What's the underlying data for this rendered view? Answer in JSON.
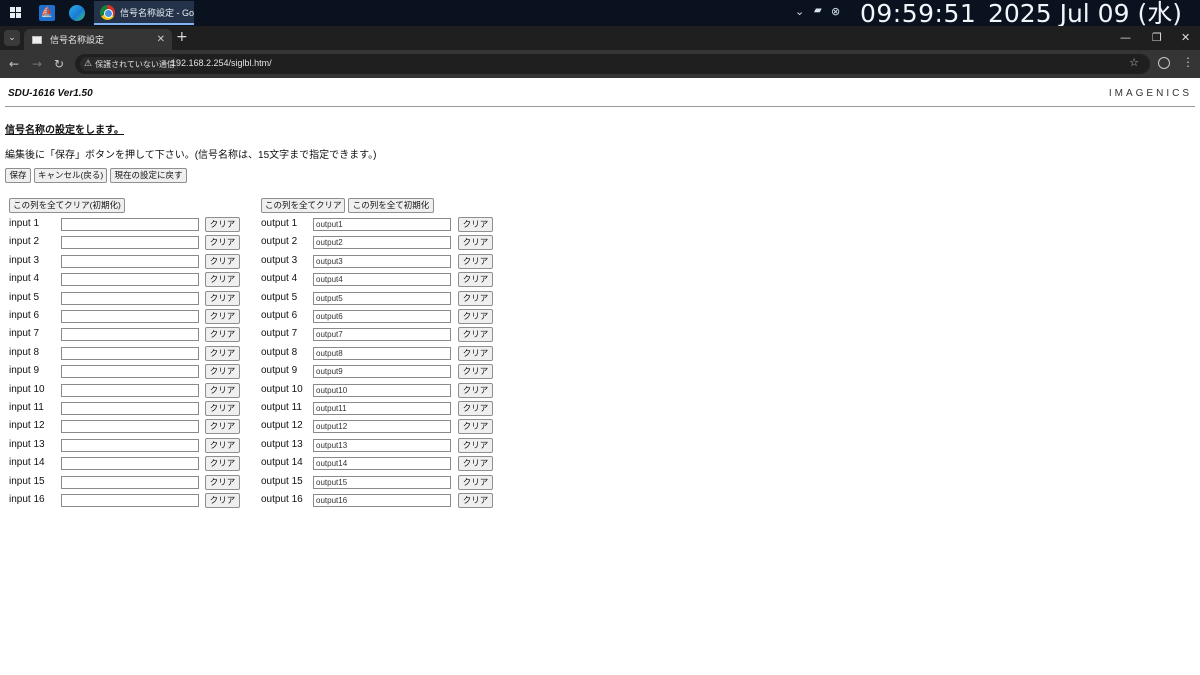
{
  "taskbar": {
    "active_window_title": "信号名称設定 - Goo...",
    "clock_time": "09:59:51",
    "clock_date": "2025   Jul 09 (水)"
  },
  "browser": {
    "tab_title": "信号名称設定",
    "security_label": "保護されていない通信",
    "url": "192.168.2.254/siglbl.htm/"
  },
  "page": {
    "product": "SDU-1616   Ver1.50",
    "brand": "IMAGENICS",
    "heading": "信号名称の設定をします。",
    "instruction": "編集後に「保存」ボタンを押して下さい。(信号名称は、15文字まで指定できます。)",
    "buttons": {
      "save": "保存",
      "cancel": "キャンセル(戻る)",
      "revert": "現在の設定に戻す"
    },
    "input_column": {
      "clear_all": "この列を全てクリア(初期化)",
      "clear_label": "クリア",
      "rows": [
        {
          "label": "input 1",
          "value": ""
        },
        {
          "label": "input 2",
          "value": ""
        },
        {
          "label": "input 3",
          "value": ""
        },
        {
          "label": "input 4",
          "value": ""
        },
        {
          "label": "input 5",
          "value": ""
        },
        {
          "label": "input 6",
          "value": ""
        },
        {
          "label": "input 7",
          "value": ""
        },
        {
          "label": "input 8",
          "value": ""
        },
        {
          "label": "input 9",
          "value": ""
        },
        {
          "label": "input 10",
          "value": ""
        },
        {
          "label": "input 11",
          "value": ""
        },
        {
          "label": "input 12",
          "value": ""
        },
        {
          "label": "input 13",
          "value": ""
        },
        {
          "label": "input 14",
          "value": ""
        },
        {
          "label": "input 15",
          "value": ""
        },
        {
          "label": "input 16",
          "value": ""
        }
      ]
    },
    "output_column": {
      "clear_all": "この列を全てクリア",
      "init_all": "この列を全て初期化",
      "clear_label": "クリア",
      "rows": [
        {
          "label": "output 1",
          "value": "output1"
        },
        {
          "label": "output 2",
          "value": "output2"
        },
        {
          "label": "output 3",
          "value": "output3"
        },
        {
          "label": "output 4",
          "value": "output4"
        },
        {
          "label": "output 5",
          "value": "output5"
        },
        {
          "label": "output 6",
          "value": "output6"
        },
        {
          "label": "output 7",
          "value": "output7"
        },
        {
          "label": "output 8",
          "value": "output8"
        },
        {
          "label": "output 9",
          "value": "output9"
        },
        {
          "label": "output 10",
          "value": "output10"
        },
        {
          "label": "output 11",
          "value": "output11"
        },
        {
          "label": "output 12",
          "value": "output12"
        },
        {
          "label": "output 13",
          "value": "output13"
        },
        {
          "label": "output 14",
          "value": "output14"
        },
        {
          "label": "output 15",
          "value": "output15"
        },
        {
          "label": "output 16",
          "value": "output16"
        }
      ]
    }
  }
}
